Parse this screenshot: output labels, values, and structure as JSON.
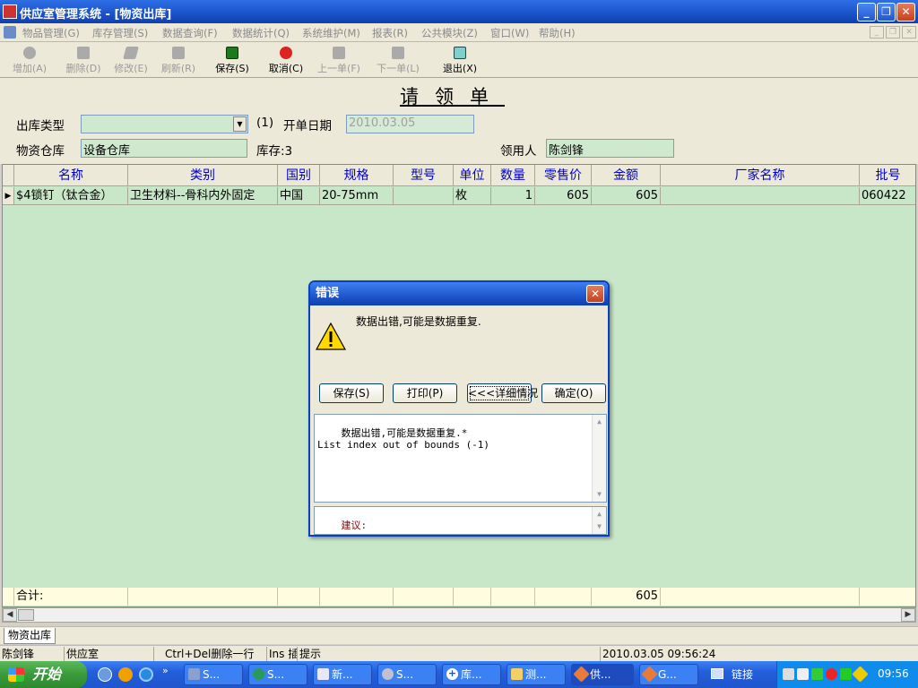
{
  "window": {
    "title": "供应室管理系统 - [物资出库]"
  },
  "menu": [
    "物品管理(G)",
    "库存管理(S)",
    "数据查询(F)",
    "数据统计(Q)",
    "系统维护(M)",
    "报表(R)",
    "公共模块(Z)",
    "窗口(W)",
    "帮助(H)"
  ],
  "toolbar": {
    "add": "增加(A)",
    "delete": "删除(D)",
    "edit": "修改(E)",
    "refresh": "刷新(R)",
    "save": "保存(S)",
    "cancel": "取消(C)",
    "prev": "上一单(F)",
    "next": "下一单(L)",
    "exit": "退出(X)"
  },
  "form": {
    "title": "请领单",
    "out_type_label": "出库类型",
    "out_type_value": "",
    "hint": "(1)",
    "date_label": "开单日期",
    "date_value": "2010.03.05",
    "warehouse_label": "物资仓库",
    "warehouse_value": "设备仓库",
    "stock_label": "库存:3",
    "receiver_label": "领用人",
    "receiver_value": "陈剑锋"
  },
  "grid": {
    "columns": [
      "名称",
      "类别",
      "国别",
      "规格",
      "型号",
      "单位",
      "数量",
      "零售价",
      "金额",
      "厂家名称",
      "批号"
    ],
    "rows": [
      {
        "name": "$4锁钉（钛合金）",
        "category": "卫生材料--骨科内外固定",
        "country": "中国",
        "spec": "20-75mm",
        "model": "",
        "unit": "枚",
        "qty": "1",
        "price": "605",
        "amount": "605",
        "maker": "",
        "batch": "060422"
      }
    ],
    "total_label": "合计:",
    "total_amount": "605"
  },
  "tab": "物资出库",
  "status": {
    "user": "陈剑锋",
    "dept": "供应室",
    "hint1": "Ctrl+Del删除一行",
    "hint2": "Ins 插",
    "hint3": "提示",
    "datetime": "2010.03.05 09:56:24"
  },
  "dialog": {
    "title": "错误",
    "message": "数据出错,可能是数据重复.",
    "buttons": {
      "save": "保存(S)",
      "print": "打印(P)",
      "details": "<<<详细情况",
      "ok": "确定(O)"
    },
    "detail_text": "数据出错,可能是数据重复.*\nList index out of bounds (-1)",
    "advice_label": "建议:"
  },
  "taskbar": {
    "start": "开始",
    "tasks": [
      "S...",
      "S...",
      "新...",
      "S...",
      "库...",
      "测...",
      "供...",
      "G..."
    ],
    "links": "链接",
    "clock": "09:56"
  },
  "colors": {
    "grid_bg": "#c8e6c8",
    "header_text": "#0000cc",
    "xp_blue": "#245edb"
  }
}
